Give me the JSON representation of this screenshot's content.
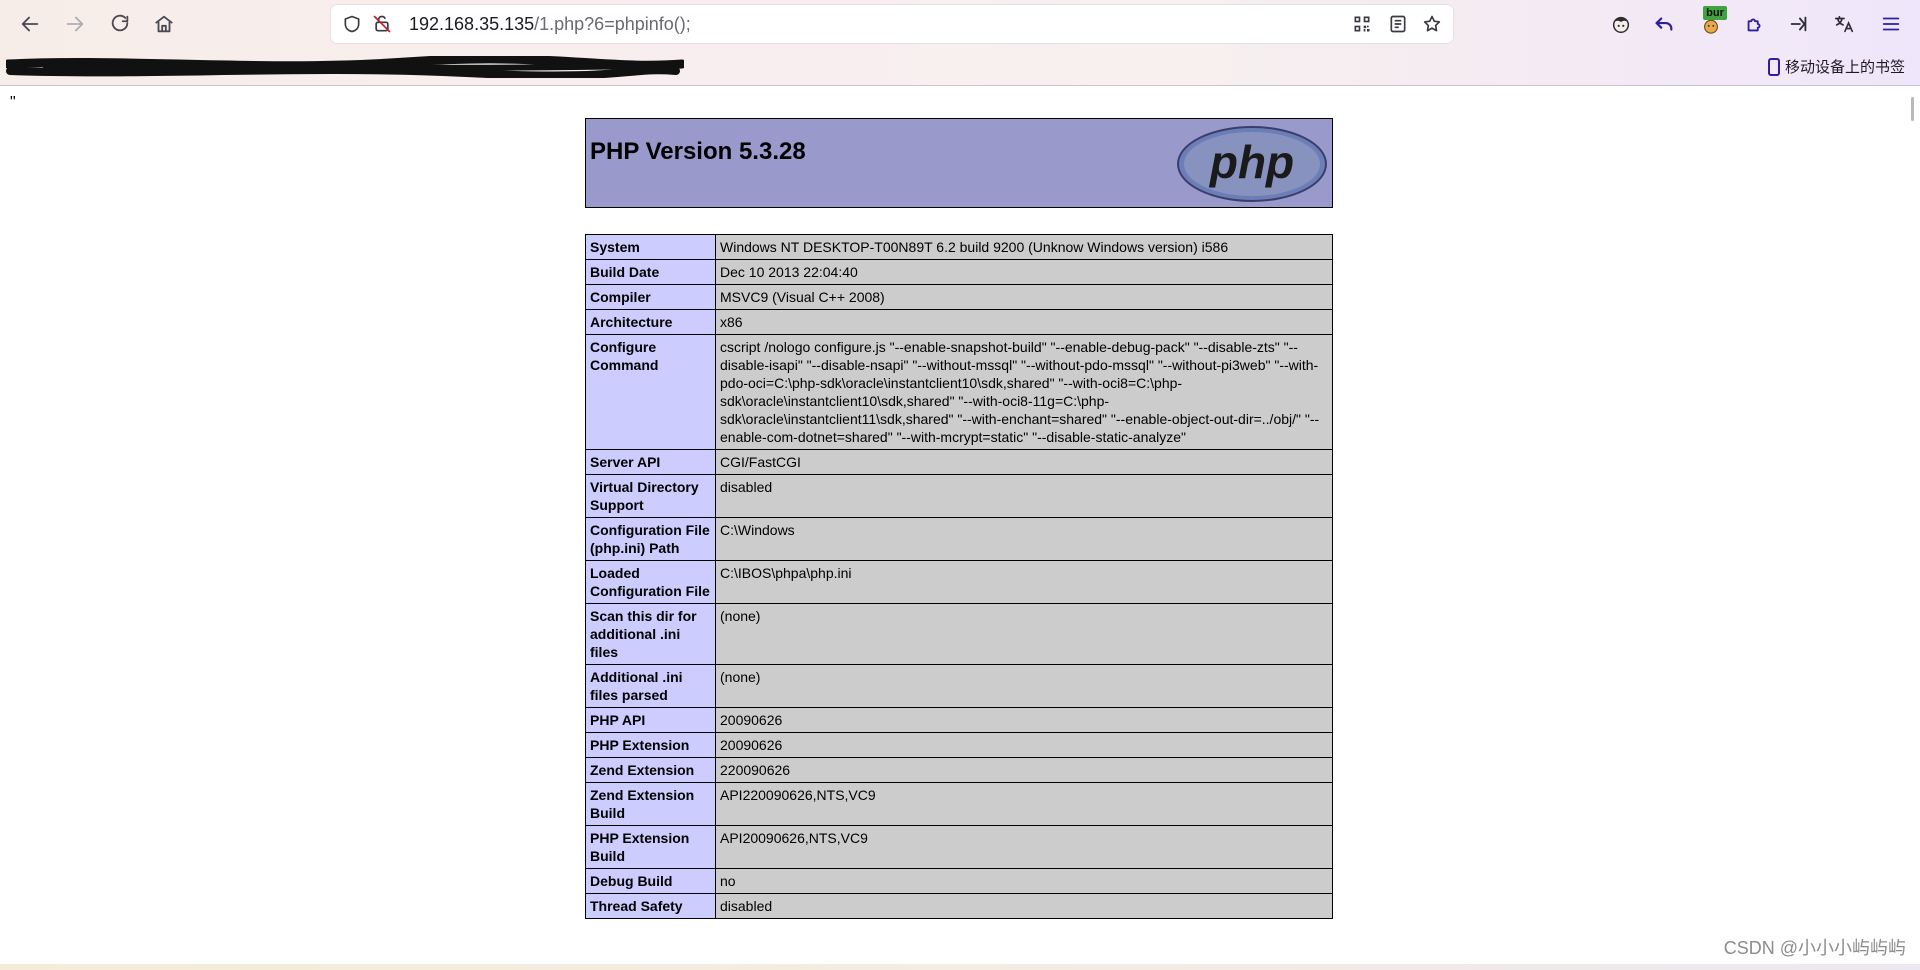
{
  "browser": {
    "url_host": "192.168.35.135",
    "url_path": "/1.php?6=phpinfo();",
    "extension_badge": "bur",
    "mobile_bookmarks_label": "移动设备上的书签"
  },
  "page": {
    "stray_text": "\"",
    "php_title": "PHP Version 5.3.28",
    "logo_text": "php",
    "rows": [
      {
        "key": "System",
        "value": "Windows NT DESKTOP-T00N89T 6.2 build 9200 (Unknow Windows version) i586"
      },
      {
        "key": "Build Date",
        "value": "Dec 10 2013 22:04:40"
      },
      {
        "key": "Compiler",
        "value": "MSVC9 (Visual C++ 2008)"
      },
      {
        "key": "Architecture",
        "value": "x86"
      },
      {
        "key": "Configure Command",
        "value": "cscript /nologo configure.js \"--enable-snapshot-build\" \"--enable-debug-pack\" \"--disable-zts\" \"--disable-isapi\" \"--disable-nsapi\" \"--without-mssql\" \"--without-pdo-mssql\" \"--without-pi3web\" \"--with-pdo-oci=C:\\php-sdk\\oracle\\instantclient10\\sdk,shared\" \"--with-oci8=C:\\php-sdk\\oracle\\instantclient10\\sdk,shared\" \"--with-oci8-11g=C:\\php-sdk\\oracle\\instantclient11\\sdk,shared\" \"--with-enchant=shared\" \"--enable-object-out-dir=../obj/\" \"--enable-com-dotnet=shared\" \"--with-mcrypt=static\" \"--disable-static-analyze\""
      },
      {
        "key": "Server API",
        "value": "CGI/FastCGI"
      },
      {
        "key": "Virtual Directory Support",
        "value": "disabled"
      },
      {
        "key": "Configuration File (php.ini) Path",
        "value": "C:\\Windows"
      },
      {
        "key": "Loaded Configuration File",
        "value": "C:\\IBOS\\phpa\\php.ini"
      },
      {
        "key": "Scan this dir for additional .ini files",
        "value": "(none)"
      },
      {
        "key": "Additional .ini files parsed",
        "value": "(none)"
      },
      {
        "key": "PHP API",
        "value": "20090626"
      },
      {
        "key": "PHP Extension",
        "value": "20090626"
      },
      {
        "key": "Zend Extension",
        "value": "220090626"
      },
      {
        "key": "Zend Extension Build",
        "value": "API220090626,NTS,VC9"
      },
      {
        "key": "PHP Extension Build",
        "value": "API20090626,NTS,VC9"
      },
      {
        "key": "Debug Build",
        "value": "no"
      },
      {
        "key": "Thread Safety",
        "value": "disabled"
      }
    ]
  },
  "watermark": "CSDN @小小小屿屿屿",
  "colors": {
    "header_bg": "#9999cc",
    "key_cell_bg": "#ccccff",
    "value_cell_bg": "#cccccc"
  },
  "icons": [
    "back-arrow-icon",
    "forward-arrow-icon",
    "reload-icon",
    "home-icon",
    "shield-icon",
    "insecure-lock-icon",
    "qr-code-icon",
    "reader-view-icon",
    "bookmark-star-icon",
    "profile-icon",
    "undo-icon",
    "extension-icon",
    "puzzle-icon",
    "pin-icon",
    "translate-icon",
    "menu-icon",
    "mobile-device-icon"
  ]
}
